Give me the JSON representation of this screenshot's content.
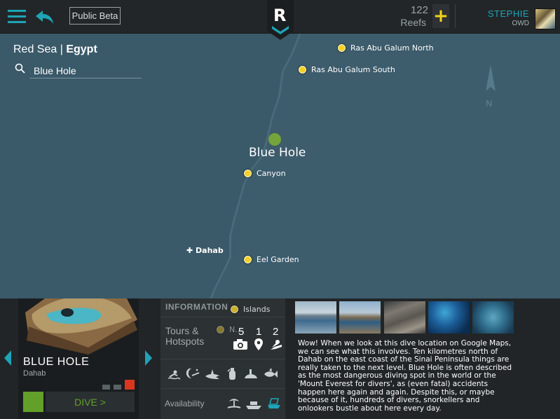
{
  "header": {
    "public_beta_label": "Public Beta",
    "logo_letter": "R",
    "reefs_count": "122",
    "reefs_label": "Reefs",
    "user_name": "STEPHIE",
    "user_level": "OWD",
    "accent_color": "#1ea4b6",
    "plus_color": "#f1d419"
  },
  "breadcrumb": {
    "region": "Red Sea |",
    "country": "Egypt"
  },
  "search": {
    "value": "Blue Hole",
    "placeholder": ""
  },
  "map": {
    "selected_site": "Blue Hole",
    "town": "Dahab",
    "compass_label": "N",
    "dive_sites": [
      {
        "name": "Ras Abu Galum North"
      },
      {
        "name": "Ras Abu Galum South"
      },
      {
        "name": "Canyon"
      },
      {
        "name": "Eel Garden"
      },
      {
        "name": "Islands"
      },
      {
        "name": "N..."
      }
    ]
  },
  "site": {
    "name": "BLUE HOLE",
    "region": "Dahab",
    "dive_button_label": "DIVE >",
    "difficulty_level": 3,
    "difficulty_max": 3
  },
  "info": {
    "information_label": "INFORMATION",
    "tours_label_line1": "Tours &",
    "tours_label_line2": "Hotspots",
    "counts": {
      "photos": "5",
      "locations": "1",
      "divers": "2"
    },
    "availability_label": "Availability",
    "activities": [
      "snorkel-icon",
      "night-dive-icon",
      "shark-icon",
      "tank-icon",
      "wreck-icon",
      "fish-icon"
    ],
    "availability_icons": [
      "beach-icon",
      "boat-icon",
      "liveaboard-icon"
    ]
  },
  "description": "Wow! When we look at this dive location on Google Maps, we can see what this involves. Ten kilometres north of Dahab on the east coast of the Sinai Peninsula things are really taken to the next level. Blue Hole is often described as the most dangerous diving spot in the world or the 'Mount Everest for divers', as (even fatal) accidents happen here again and again. Despite this, or maybe because of it, hundreds of divers, snorkellers and onlookers bustle about here every day."
}
